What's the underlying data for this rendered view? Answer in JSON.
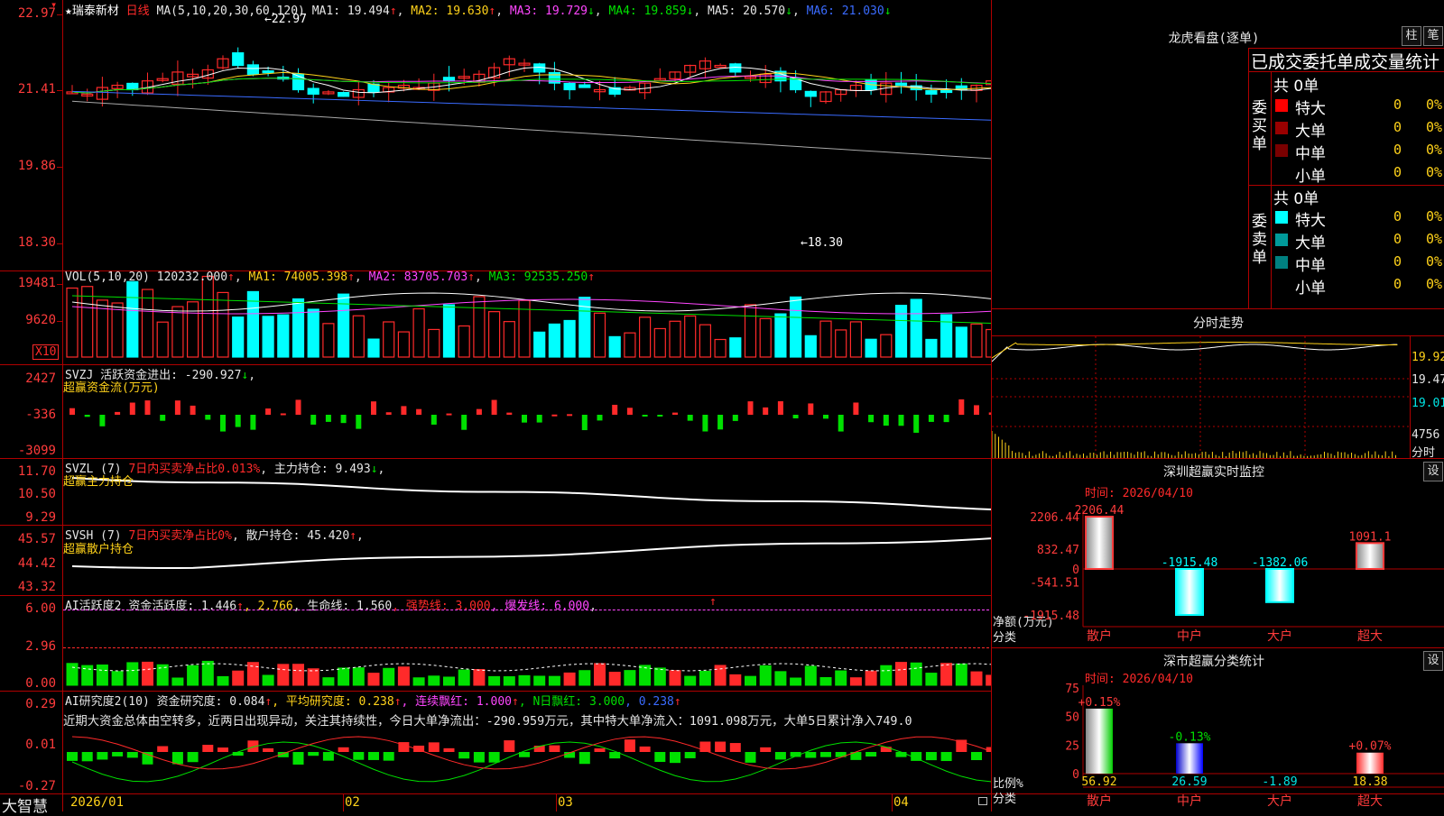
{
  "app": {
    "logo": "大智慧"
  },
  "stock": {
    "star": "★",
    "name": "瑞泰新材",
    "period": "日线"
  },
  "price": {
    "header": {
      "ma_params": "MA(5,10,20,30,60,120)",
      "ma1": "MA1: 19.494",
      "ma1_arrow": "↑",
      "ma2": "MA2: 19.630",
      "ma2_arrow": "↑",
      "ma3": "MA3: 19.729",
      "ma3_arrow": "↓",
      "ma4": "MA4: 19.859",
      "ma4_arrow": "↓",
      "ma5": "MA5: 20.570",
      "ma5_arrow": "↓",
      "ma6": "MA6: 21.030",
      "ma6_arrow": "↓"
    },
    "y_labels": [
      "22.97",
      "21.41",
      "19.86",
      "18.30"
    ],
    "top_mark": "▾",
    "high_note": "←22.97",
    "low_note": "←18.30"
  },
  "vol": {
    "header": {
      "params": "VOL(5,10,20)",
      "v": "120232.000",
      "v_arrow": "↑",
      "ma1": "MA1: 74005.398",
      "ma1_arrow": "↑",
      "ma2": "MA2: 83705.703",
      "ma2_arrow": "↑",
      "ma3": "MA3: 92535.250",
      "ma3_arrow": "↑"
    },
    "y_labels": [
      "19481",
      "9620"
    ],
    "unit": "X10"
  },
  "svzj": {
    "header": {
      "name": "SVZJ",
      "label": "活跃资金进出: -290.927",
      "arrow": "↓"
    },
    "subtitle": "超赢资金流(万元)",
    "y_labels": [
      "2427",
      "-336",
      "-3099"
    ]
  },
  "svzl": {
    "header": {
      "name": "SVZL (7)",
      "ratio": "7日内买卖净占比0.013%",
      "hold": "主力持仓: 9.493",
      "arrow": "↓",
      "tail": ","
    },
    "subtitle": "超赢主力持仓",
    "y_labels": [
      "11.70",
      "10.50",
      "9.29"
    ]
  },
  "svsh": {
    "header": {
      "name": "SVSH (7)",
      "ratio": "7日内买卖净占比0%",
      "hold": "散户持仓: 45.420",
      "arrow": "↑",
      "tail": ","
    },
    "subtitle": "超赢散户持仓",
    "y_labels": [
      "45.57",
      "44.42",
      "43.32"
    ]
  },
  "ai1": {
    "header": {
      "name": "AI活跃度2",
      "act": "资金活跃度: 1.446",
      "a1": "↑",
      "v2": ", 2.766",
      "life": ", 生命线: 1.560",
      "strong": ", 强势线: 3.000",
      "burst": ", 爆发线: 6.000",
      "tail": ",",
      "mark": "↑"
    },
    "y_labels": [
      "6.00",
      "2.96",
      "0.00"
    ]
  },
  "ai2": {
    "header": {
      "name": "AI研究度2(10)",
      "res": "资金研究度: 0.084",
      "a1": "↑",
      "avg": ", 平均研究度: 0.238",
      "a2": "↑",
      "cont": ", 连续飘红: 1.000",
      "a3": "↑",
      "nday": ", N日飘红: 3.000",
      "n": ", 0.238",
      "a4": "↑"
    },
    "comment": "近期大资金总体由空转多，近两日出现异动，关注其持续性，今日大单净流出：-290.959万元，其中特大单净流入：1091.098万元，大单5日累计净入749.0",
    "y_labels": [
      "0.29",
      "0.01",
      "-0.27"
    ]
  },
  "x_axis": {
    "labels": [
      "2026/01",
      "02",
      "03",
      "04"
    ]
  },
  "dragon": {
    "title": "龙虎看盘(逐单)",
    "btn1": "柱",
    "btn2": "笔",
    "subtitle": "已成交委托单成交量统计",
    "buy_side": "委买单",
    "sell_side": "委卖单",
    "buy_total": "共 0单",
    "sell_total": "共 0单",
    "buy_rows": [
      {
        "label": "特大",
        "n": "0",
        "p": "0%",
        "color": "#ff0000"
      },
      {
        "label": "大单",
        "n": "0",
        "p": "0%",
        "color": "#9a0000"
      },
      {
        "label": "中单",
        "n": "0",
        "p": "0%",
        "color": "#7a0000"
      },
      {
        "label": "小单",
        "n": "0",
        "p": "0%",
        "color": "#000000"
      }
    ],
    "sell_rows": [
      {
        "label": "特大",
        "n": "0",
        "p": "0%",
        "color": "#00ffff"
      },
      {
        "label": "大单",
        "n": "0",
        "p": "0%",
        "color": "#009999"
      },
      {
        "label": "中单",
        "n": "0",
        "p": "0%",
        "color": "#008080"
      },
      {
        "label": "小单",
        "n": "0",
        "p": "0%",
        "color": "#000000"
      }
    ]
  },
  "intraday": {
    "title": "分时走势",
    "labels": [
      "19.92",
      "19.47",
      "19.01"
    ],
    "vol_label": "4756",
    "unit": "分时"
  },
  "sz_monitor": {
    "title": "深圳超赢实时监控",
    "btn": "设",
    "time": "时间: 2026/04/10",
    "y_labels": [
      "2206.44",
      "832.47",
      "0",
      "-541.51",
      "-1915.48"
    ],
    "y_axis_label": "净额(万元)",
    "x_axis_label": "分类",
    "bars": [
      {
        "cat": "散户",
        "value": 2206.44,
        "label": "2206.44"
      },
      {
        "cat": "中户",
        "value": -1915.48,
        "label": "-1915.48"
      },
      {
        "cat": "大户",
        "value": -1382.06,
        "label": "-1382.06"
      },
      {
        "cat": "超大",
        "value": 1091.1,
        "label": "1091.1"
      }
    ]
  },
  "sz_class": {
    "title": "深市超赢分类统计",
    "btn": "设",
    "time": "时间: 2026/04/10",
    "y_labels": [
      "75",
      "50",
      "25",
      "0"
    ],
    "y_axis_label": "比例%",
    "x_axis_label": "分类",
    "bars": [
      {
        "cat": "散户",
        "value": 56.92,
        "bottom": "56.92",
        "top": "+0.15%"
      },
      {
        "cat": "中户",
        "value": 26.59,
        "bottom": "26.59",
        "top": "-0.13%"
      },
      {
        "cat": "大户",
        "value": -1.89,
        "bottom": "-1.89",
        "top": ""
      },
      {
        "cat": "超大",
        "value": 18.38,
        "bottom": "18.38",
        "top": "+0.07%"
      }
    ]
  },
  "colors": {
    "up": "#ff2a2a",
    "down": "#00ffff",
    "grid": "#b00000",
    "ma1": "#ffffff",
    "ma2": "#ffd21a",
    "ma3": "#ff46ff",
    "ma4": "#00e000",
    "ma5": "#a8a8a8",
    "ma6": "#3a6bff"
  }
}
